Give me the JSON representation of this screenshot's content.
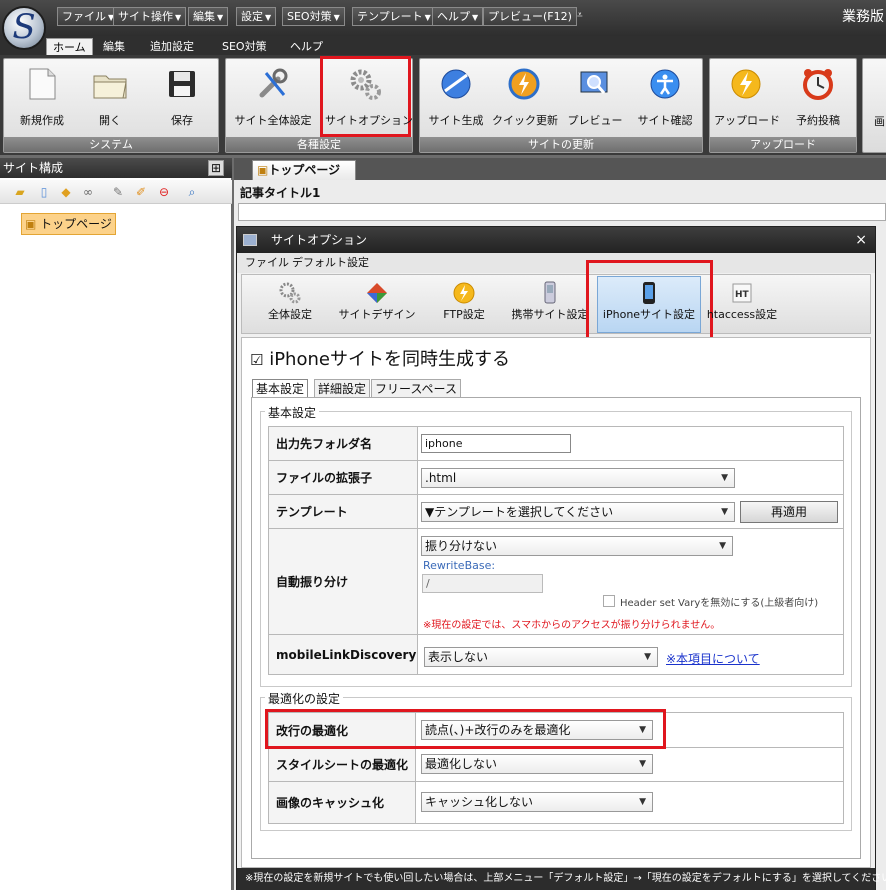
{
  "app": {
    "menus": [
      "ファイル",
      "サイト操作",
      "編集",
      "設定",
      "SEO対策",
      "テンプレート",
      "ヘルプ",
      "プレビュー(F12)"
    ],
    "top_right": "業務版"
  },
  "ribbon_tabs": [
    "ホーム",
    "編集",
    "追加設定",
    "SEO対策",
    "ヘルプ"
  ],
  "ribbon": {
    "groups": {
      "system": "システム",
      "settings": "各種設定",
      "update": "サイトの更新",
      "upload": "アップロード"
    },
    "buttons": {
      "new": "新規作成",
      "open": "開く",
      "save": "保存",
      "site_settings": "サイト全体設定",
      "site_options": "サイトオプション",
      "generate": "サイト生成",
      "quick_update": "クイック更新",
      "preview": "プレビュー",
      "site_check": "サイト確認",
      "upload": "アップロード",
      "scheduled_post": "予約投稿",
      "partial": "画"
    }
  },
  "left_panel": {
    "title": "サイト構成",
    "tree_item": "トップページ"
  },
  "document": {
    "tab": "トップページ",
    "field_label": "記事タイトル1"
  },
  "dialog": {
    "title": "サイトオプション",
    "close": "×",
    "menu": [
      "ファイル",
      "デフォルト設定"
    ],
    "toolbar": {
      "general": "全体設定",
      "design": "サイトデザイン",
      "ftp": "FTP設定",
      "mobile": "携帯サイト設定",
      "iphone": "iPhoneサイト設定",
      "htaccess": "htaccess設定"
    },
    "generate_checkbox": "iPhoneサイトを同時生成する",
    "subtabs": [
      "基本設定",
      "詳細設定",
      "フリースペース"
    ],
    "basic": {
      "legend": "基本設定",
      "output_folder_label": "出力先フォルダ名",
      "output_folder_value": "iphone",
      "extension_label": "ファイルの拡張子",
      "extension_value": ".html",
      "template_label": "テンプレート",
      "template_value": "▼テンプレートを選択してください",
      "reapply": "再適用",
      "auto_label": "自動振り分け",
      "auto_value": "振り分けない",
      "rewrite_label": "RewriteBase:",
      "rewrite_value": "/",
      "header_vary": "Header set Varyを無効にする(上級者向け)",
      "warning": "※現在の設定では、スマホからのアクセスが振り分けられません。",
      "mobile_link_label": "mobileLinkDiscovery",
      "mobile_link_value": "表示しない",
      "about_link": "※本項目について"
    },
    "optimize": {
      "legend": "最適化の設定",
      "linebreak_label": "改行の最適化",
      "linebreak_value": "読点(、)+改行のみを最適化",
      "stylesheet_label": "スタイルシートの最適化",
      "stylesheet_value": "最適化しない",
      "image_label": "画像のキャッシュ化",
      "image_value": "キャッシュ化しない"
    },
    "footer": "※現在の設定を新規サイトでも使い回したい場合は、上部メニュー「デフォルト設定」→「現在の設定をデフォルトにする」を選択してください。"
  },
  "colors": {
    "highlight_red": "#e0161e",
    "warning_text": "#e0161e",
    "link_blue": "#1a33cc"
  }
}
